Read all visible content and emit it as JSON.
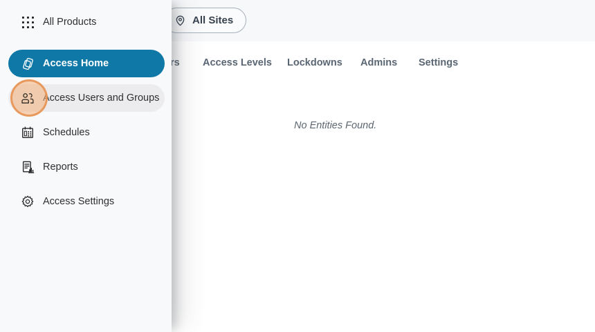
{
  "colors": {
    "accent_blue": "#0f78a6",
    "sidebar_bg": "#f8f9fb",
    "topbar_bg": "#f7f8fa",
    "hover_item_bg": "#ececee",
    "highlight_circle_fill": "#f4b17a",
    "highlight_circle_border": "#e79454",
    "tab_text": "#5a6673",
    "sidebar_label_text": "#2f2f2f",
    "empty_state_text": "#5c6670",
    "pill_border": "#a7afbb",
    "pill_text": "#38424f"
  },
  "topbar": {
    "all_sites_label": "All Sites",
    "all_sites_icon": "location-pin-icon"
  },
  "sidebar": {
    "items": [
      {
        "label": "All Products",
        "icon": "grid-icon",
        "state": "normal"
      },
      {
        "label": "Access Home",
        "icon": "cards-icon",
        "state": "active"
      },
      {
        "label": "Access Users and Groups",
        "icon": "users-icon",
        "state": "highlighted-click"
      },
      {
        "label": "Schedules",
        "icon": "calendar-icon",
        "state": "normal"
      },
      {
        "label": "Reports",
        "icon": "report-icon",
        "state": "normal"
      },
      {
        "label": "Access Settings",
        "icon": "gear-icon",
        "state": "normal"
      }
    ]
  },
  "main": {
    "tabs": [
      {
        "label": "rs",
        "partial": true
      },
      {
        "label": "Access Levels"
      },
      {
        "label": "Lockdowns"
      },
      {
        "label": "Admins"
      },
      {
        "label": "Settings"
      }
    ],
    "empty_state": "No Entities Found."
  }
}
